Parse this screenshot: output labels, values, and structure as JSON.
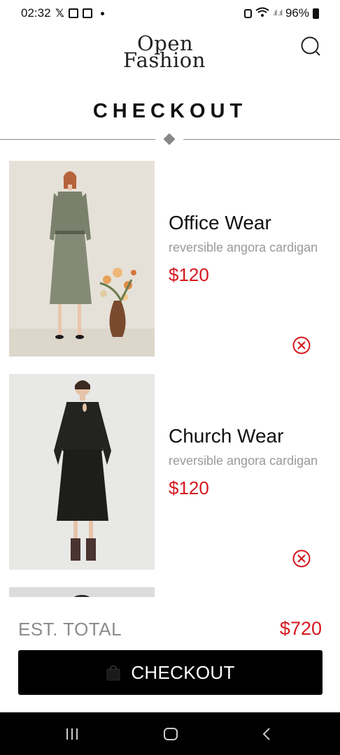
{
  "status_bar": {
    "time": "02:32",
    "battery": "96%"
  },
  "header": {
    "logo_line1": "Open",
    "logo_line2": "Fashion",
    "search_icon": "search-icon"
  },
  "page": {
    "title": "CHECKOUT"
  },
  "products": [
    {
      "name": "Office Wear",
      "description": "reversible angora cardigan",
      "price": "$120",
      "remove_icon": "close-circle-icon"
    },
    {
      "name": "Church Wear",
      "description": "reversible angora cardigan",
      "price": "$120",
      "remove_icon": "close-circle-icon"
    }
  ],
  "footer": {
    "total_label": "EST. TOTAL",
    "total_value": "$720",
    "checkout_label": "CHECKOUT",
    "checkout_icon": "shopping-bag-icon"
  },
  "colors": {
    "accent": "#d6181f",
    "button_bg": "#000000",
    "muted_text": "#9a9a9a"
  },
  "nav_bar": {
    "icons": [
      "recent-apps-icon",
      "home-icon",
      "back-icon"
    ]
  }
}
